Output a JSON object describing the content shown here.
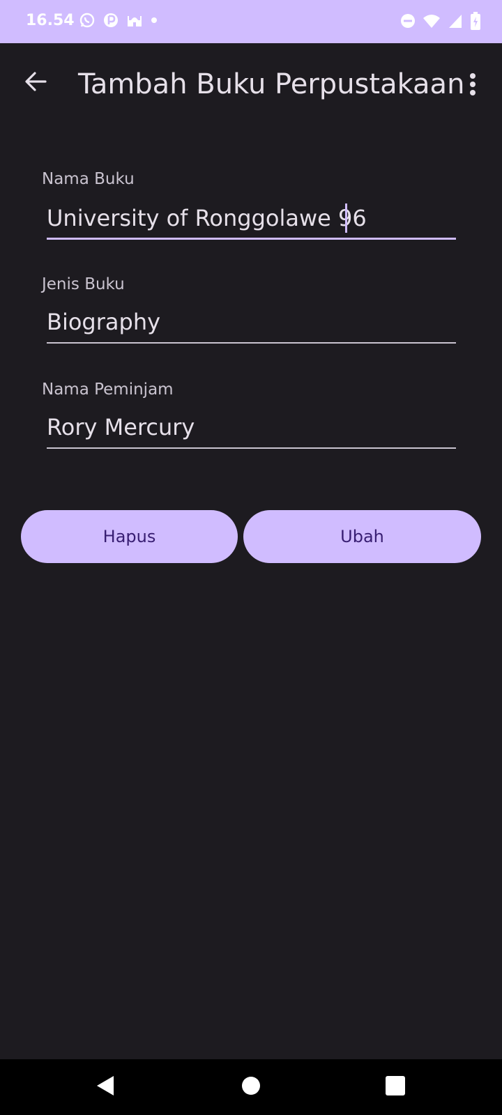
{
  "status_bar": {
    "time": "16.54",
    "left_icons": [
      "whatsapp-icon",
      "app-icon",
      "mosque-icon",
      "dot-icon"
    ],
    "right_icons": [
      "do-not-disturb-icon",
      "wifi-icon",
      "signal-icon",
      "battery-charging-icon"
    ],
    "background_color": "#d0bcff"
  },
  "app_bar": {
    "title": "Tambah Buku Perpustakaan",
    "back_icon": "arrow-back-icon",
    "menu_icon": "more-vert-icon"
  },
  "form": {
    "nama_buku": {
      "label": "Nama Buku",
      "value": "University of Ronggolawe 96"
    },
    "jenis_buku": {
      "label": "Jenis Buku",
      "value": "Biography"
    },
    "nama_peminjam": {
      "label": "Nama Peminjam",
      "value": "Rory Mercury"
    }
  },
  "actions": {
    "delete_label": "Hapus",
    "update_label": "Ubah"
  },
  "nav_bar": {
    "icons": [
      "back-triangle-icon",
      "home-circle-icon",
      "recents-square-icon"
    ]
  },
  "colors": {
    "accent": "#d0bcff",
    "button_text": "#381e72",
    "background": "#1d1b20",
    "text": "#e6e0e9"
  }
}
